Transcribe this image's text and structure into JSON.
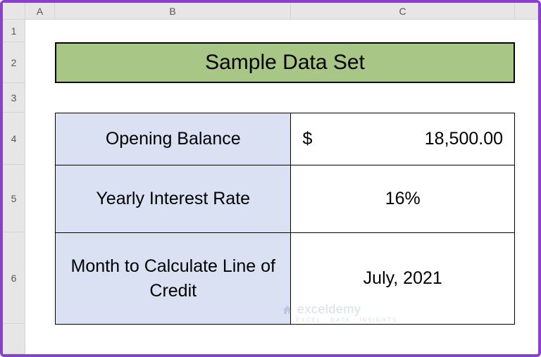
{
  "columns": {
    "A": "A",
    "B": "B",
    "C": "C"
  },
  "rows": {
    "1": "1",
    "2": "2",
    "3": "3",
    "4": "4",
    "5": "5",
    "6": "6"
  },
  "title": "Sample Data Set",
  "table": {
    "openingBalance": {
      "label": "Opening Balance",
      "currency": "$",
      "value": "18,500.00"
    },
    "interestRate": {
      "label": "Yearly Interest Rate",
      "value": "16%"
    },
    "monthCalc": {
      "label": "Month to Calculate Line of Credit",
      "value": "July, 2021"
    }
  },
  "watermark": {
    "title": "exceldemy",
    "sub": "EXCEL · DATA · INSIGHTS"
  }
}
